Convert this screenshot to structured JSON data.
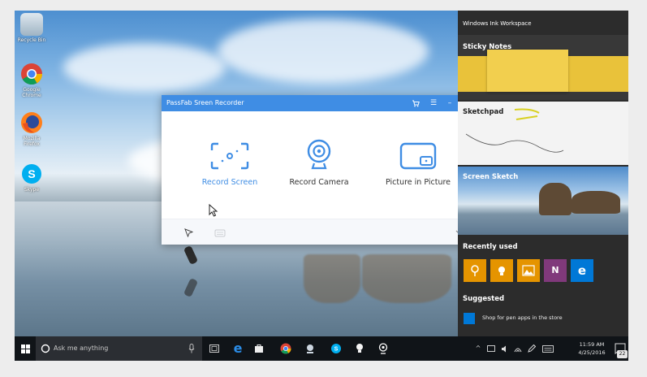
{
  "desktop": {
    "icons": [
      {
        "label": "Recycle Bin",
        "icon": "recycle-bin-icon"
      },
      {
        "label": "Google Chrome",
        "icon": "chrome-icon"
      },
      {
        "label": "Mozilla Firefox",
        "icon": "firefox-icon"
      },
      {
        "label": "Skype",
        "icon": "skype-icon"
      }
    ]
  },
  "app": {
    "title": "PassFab Sreen Recorder",
    "modes": [
      {
        "label": "Record Screen",
        "icon": "record-screen-icon"
      },
      {
        "label": "Record Camera",
        "icon": "webcam-icon"
      },
      {
        "label": "Picture in Picture",
        "icon": "picture-in-picture-icon"
      }
    ],
    "accent": "#3f8de4"
  },
  "ink": {
    "header": "Windows Ink Workspace",
    "sticky": "Sticky Notes",
    "sketchpad": "Sketchpad",
    "screen_sketch": "Screen Sketch",
    "recent": "Recently used",
    "recent_icons": [
      "maps-icon",
      "tips-icon",
      "photos-icon",
      "onenote-icon",
      "edge-icon"
    ],
    "suggested": "Suggested",
    "store_text": "Shop for pen apps in the store"
  },
  "taskbar": {
    "search_placeholder": "Ask me anything",
    "time": "11:59 AM",
    "date": "4/25/2016",
    "notifications": "22"
  }
}
